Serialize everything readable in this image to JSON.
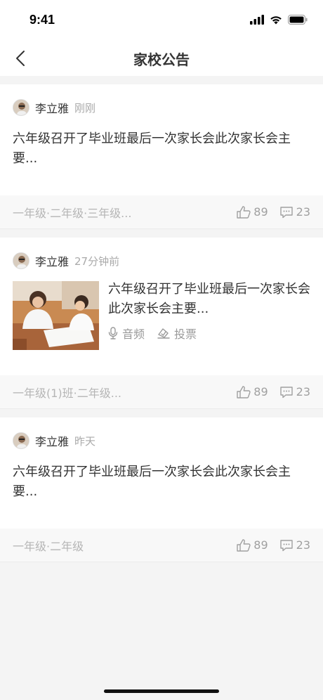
{
  "status": {
    "time": "9:41"
  },
  "nav": {
    "title": "家校公告"
  },
  "posts": [
    {
      "author": "李立雅",
      "time": "刚刚",
      "text": "六年级召开了毕业班最后一次家长会此次家长会主要...",
      "tags": "一年级·二年级·三年级...",
      "likes": "89",
      "comments": "23"
    },
    {
      "author": "李立雅",
      "time": "27分钟前",
      "text": "六年级召开了毕业班最后一次家长会此次家长会主要...",
      "attachments": [
        "音频",
        "投票"
      ],
      "tags": "一年级(1)班·二年级...",
      "likes": "89",
      "comments": "23"
    },
    {
      "author": "李立雅",
      "time": "昨天",
      "text": "六年级召开了毕业班最后一次家长会此次家长会主要...",
      "tags": "一年级·二年级",
      "likes": "89",
      "comments": "23"
    }
  ]
}
